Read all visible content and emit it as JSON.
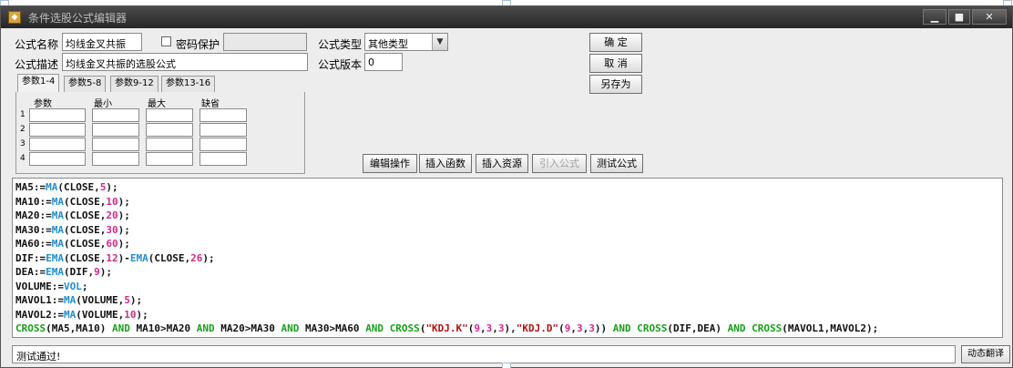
{
  "window": {
    "title": "条件选股公式编辑器",
    "minimize_glyph": "▁",
    "maximize_glyph": "■",
    "close_glyph": "✕",
    "app_icon_glyph": "◆"
  },
  "form": {
    "name_label": "公式名称",
    "name_value": "均线金叉共振",
    "password_label": "密码保护",
    "desc_label": "公式描述",
    "desc_value": "均线金叉共振的选股公式",
    "type_label": "公式类型",
    "type_value": "其他类型",
    "version_label": "公式版本",
    "version_value": "0"
  },
  "side_buttons": {
    "ok": "确  定",
    "cancel": "取  消",
    "save_as": "另存为"
  },
  "param_tabs": [
    "参数1-4",
    "参数5-8",
    "参数9-12",
    "参数13-16"
  ],
  "param_headers": [
    "参数",
    "最小",
    "最大",
    "缺省"
  ],
  "param_rows": [
    "1",
    "2",
    "3",
    "4"
  ],
  "action_buttons": {
    "edit": "编辑操作",
    "insert_func": "插入函数",
    "insert_res": "插入资源",
    "import": "引入公式",
    "test": "测试公式"
  },
  "code_lines": [
    [
      [
        "v",
        "MA5:="
      ],
      [
        "f",
        "MA"
      ],
      [
        "op",
        "("
      ],
      [
        "v",
        "CLOSE,"
      ],
      [
        "n",
        "5"
      ],
      [
        "op",
        ");"
      ]
    ],
    [
      [
        "v",
        "MA10:="
      ],
      [
        "f",
        "MA"
      ],
      [
        "op",
        "("
      ],
      [
        "v",
        "CLOSE,"
      ],
      [
        "n",
        "10"
      ],
      [
        "op",
        ");"
      ]
    ],
    [
      [
        "v",
        "MA20:="
      ],
      [
        "f",
        "MA"
      ],
      [
        "op",
        "("
      ],
      [
        "v",
        "CLOSE,"
      ],
      [
        "n",
        "20"
      ],
      [
        "op",
        ");"
      ]
    ],
    [
      [
        "v",
        "MA30:="
      ],
      [
        "f",
        "MA"
      ],
      [
        "op",
        "("
      ],
      [
        "v",
        "CLOSE,"
      ],
      [
        "n",
        "30"
      ],
      [
        "op",
        ");"
      ]
    ],
    [
      [
        "v",
        "MA60:="
      ],
      [
        "f",
        "MA"
      ],
      [
        "op",
        "("
      ],
      [
        "v",
        "CLOSE,"
      ],
      [
        "n",
        "60"
      ],
      [
        "op",
        ");"
      ]
    ],
    [
      [
        "v",
        "DIF:="
      ],
      [
        "f",
        "EMA"
      ],
      [
        "op",
        "("
      ],
      [
        "v",
        "CLOSE,"
      ],
      [
        "n",
        "12"
      ],
      [
        "op",
        ")-"
      ],
      [
        "f",
        "EMA"
      ],
      [
        "op",
        "("
      ],
      [
        "v",
        "CLOSE,"
      ],
      [
        "n",
        "26"
      ],
      [
        "op",
        ");"
      ]
    ],
    [
      [
        "v",
        "DEA:="
      ],
      [
        "f",
        "EMA"
      ],
      [
        "op",
        "("
      ],
      [
        "v",
        "DIF,"
      ],
      [
        "n",
        "9"
      ],
      [
        "op",
        ");"
      ]
    ],
    [
      [
        "v",
        "VOLUME:="
      ],
      [
        "f",
        "VOL"
      ],
      [
        "op",
        ";"
      ]
    ],
    [
      [
        "v",
        "MAVOL1:="
      ],
      [
        "f",
        "MA"
      ],
      [
        "op",
        "("
      ],
      [
        "v",
        "VOLUME,"
      ],
      [
        "n",
        "5"
      ],
      [
        "op",
        ");"
      ]
    ],
    [
      [
        "v",
        "MAVOL2:="
      ],
      [
        "f",
        "MA"
      ],
      [
        "op",
        "("
      ],
      [
        "v",
        "VOLUME,"
      ],
      [
        "n",
        "10"
      ],
      [
        "op",
        ");"
      ]
    ],
    [
      [
        "k",
        "CROSS"
      ],
      [
        "op",
        "(MA5,MA10) "
      ],
      [
        "k",
        "AND"
      ],
      [
        "op",
        " MA10>MA20 "
      ],
      [
        "k",
        "AND"
      ],
      [
        "op",
        " MA20>MA30 "
      ],
      [
        "k",
        "AND"
      ],
      [
        "op",
        " MA30>MA60 "
      ],
      [
        "k",
        "AND"
      ],
      [
        "op",
        " "
      ],
      [
        "k",
        "CROSS"
      ],
      [
        "op",
        "("
      ],
      [
        "s",
        "\"KDJ.K\""
      ],
      [
        "op",
        "("
      ],
      [
        "n",
        "9"
      ],
      [
        "op",
        ","
      ],
      [
        "n",
        "3"
      ],
      [
        "op",
        ","
      ],
      [
        "n",
        "3"
      ],
      [
        "op",
        "),"
      ],
      [
        "s",
        "\"KDJ.D\""
      ],
      [
        "op",
        "("
      ],
      [
        "n",
        "9"
      ],
      [
        "op",
        ","
      ],
      [
        "n",
        "3"
      ],
      [
        "op",
        ","
      ],
      [
        "n",
        "3"
      ],
      [
        "op",
        ")) "
      ],
      [
        "k",
        "AND"
      ],
      [
        "op",
        " "
      ],
      [
        "k",
        "CROSS"
      ],
      [
        "op",
        "(DIF,DEA) "
      ],
      [
        "k",
        "AND"
      ],
      [
        "op",
        " "
      ],
      [
        "k",
        "CROSS"
      ],
      [
        "op",
        "(MAVOL1,MAVOL2);"
      ]
    ]
  ],
  "status": {
    "text": "测试通过!",
    "hint_button": "动态翻译"
  },
  "colors": {
    "variable": "#111111",
    "function": "#1f8ed0",
    "keyword": "#18a01a",
    "number": "#d02a8a",
    "string": "#b31212"
  }
}
